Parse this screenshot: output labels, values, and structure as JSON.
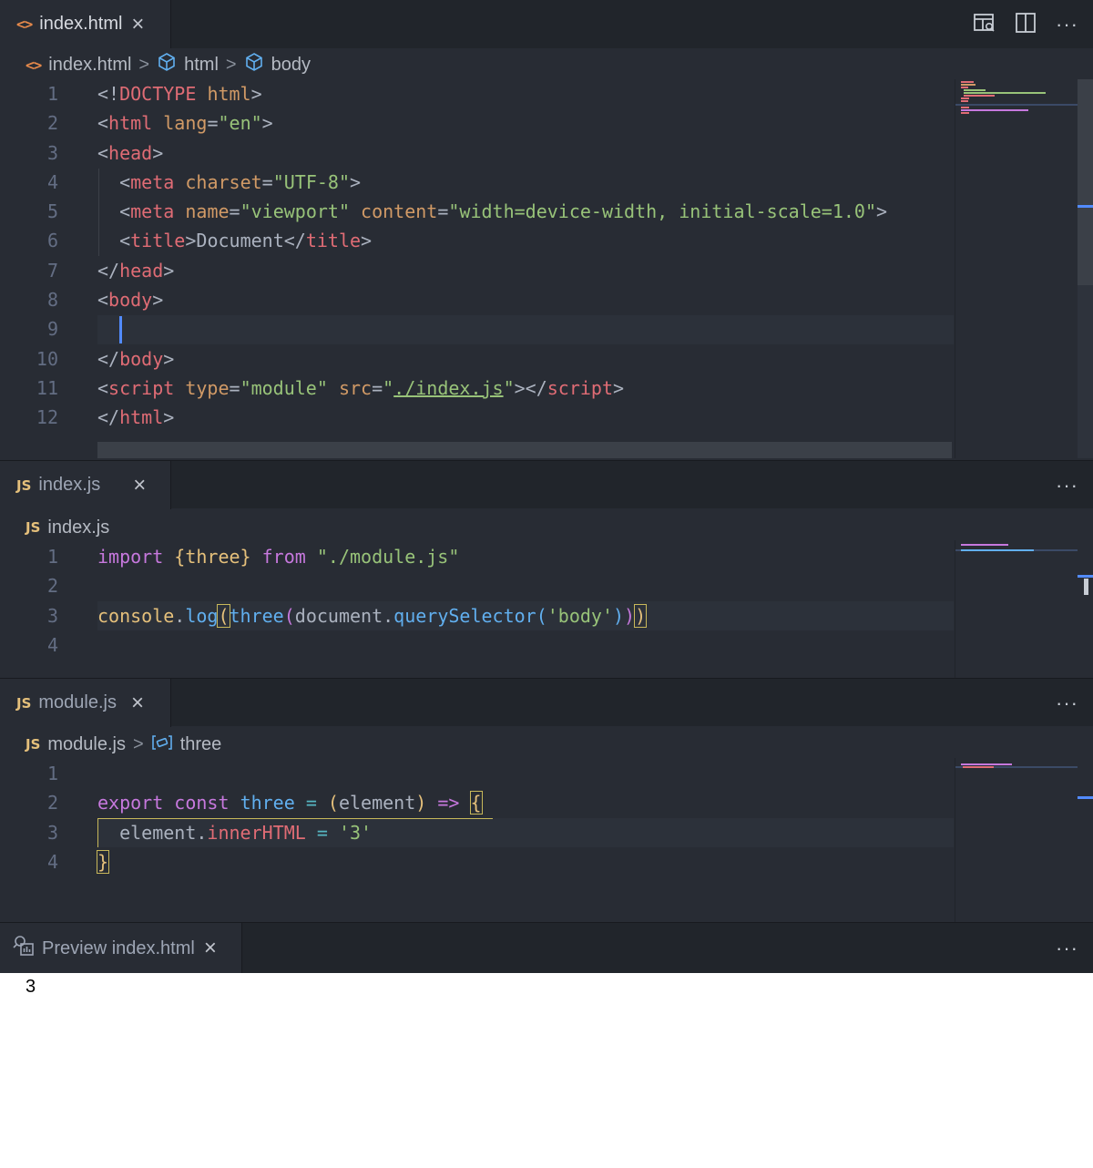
{
  "editor1": {
    "tab_label": "index.html",
    "breadcrumb": [
      "index.html",
      "html",
      "body"
    ],
    "lines": [
      [
        [
          "punc",
          "<!"
        ],
        [
          "tag",
          "DOCTYPE"
        ],
        [
          "plain",
          " "
        ],
        [
          "attr",
          "html"
        ],
        [
          "punc",
          ">"
        ]
      ],
      [
        [
          "punc",
          "<"
        ],
        [
          "tag",
          "html"
        ],
        [
          "plain",
          " "
        ],
        [
          "attr",
          "lang"
        ],
        [
          "punc",
          "="
        ],
        [
          "str",
          "\"en\""
        ],
        [
          "punc",
          ">"
        ]
      ],
      [
        [
          "punc",
          "<"
        ],
        [
          "tag",
          "head"
        ],
        [
          "punc",
          ">"
        ]
      ],
      [
        [
          "plain",
          "  "
        ],
        [
          "punc",
          "<"
        ],
        [
          "tag",
          "meta"
        ],
        [
          "plain",
          " "
        ],
        [
          "attr",
          "charset"
        ],
        [
          "punc",
          "="
        ],
        [
          "str",
          "\"UTF-8\""
        ],
        [
          "punc",
          ">"
        ]
      ],
      [
        [
          "plain",
          "  "
        ],
        [
          "punc",
          "<"
        ],
        [
          "tag",
          "meta"
        ],
        [
          "plain",
          " "
        ],
        [
          "attr",
          "name"
        ],
        [
          "punc",
          "="
        ],
        [
          "str",
          "\"viewport\""
        ],
        [
          "plain",
          " "
        ],
        [
          "attr",
          "content"
        ],
        [
          "punc",
          "="
        ],
        [
          "str",
          "\"width=device-width, initial-scale=1.0\""
        ],
        [
          "punc",
          ">"
        ]
      ],
      [
        [
          "plain",
          "  "
        ],
        [
          "punc",
          "<"
        ],
        [
          "tag",
          "title"
        ],
        [
          "punc",
          ">"
        ],
        [
          "plain",
          "Document"
        ],
        [
          "punc",
          "</"
        ],
        [
          "tag",
          "title"
        ],
        [
          "punc",
          ">"
        ]
      ],
      [
        [
          "punc",
          "</"
        ],
        [
          "tag",
          "head"
        ],
        [
          "punc",
          ">"
        ]
      ],
      [
        [
          "punc",
          "<"
        ],
        [
          "tag",
          "body"
        ],
        [
          "punc",
          ">"
        ]
      ],
      [
        [
          "plain",
          "  "
        ]
      ],
      [
        [
          "punc",
          "</"
        ],
        [
          "tag",
          "body"
        ],
        [
          "punc",
          ">"
        ]
      ],
      [
        [
          "punc",
          "<"
        ],
        [
          "tag",
          "script"
        ],
        [
          "plain",
          " "
        ],
        [
          "attr",
          "type"
        ],
        [
          "punc",
          "="
        ],
        [
          "str",
          "\"module\""
        ],
        [
          "plain",
          " "
        ],
        [
          "attr",
          "src"
        ],
        [
          "punc",
          "="
        ],
        [
          "str",
          "\""
        ],
        [
          "strU",
          "./index.js"
        ],
        [
          "str",
          "\""
        ],
        [
          "punc",
          "></"
        ],
        [
          "tag",
          "script"
        ],
        [
          "punc",
          ">"
        ]
      ],
      [
        [
          "punc",
          "</"
        ],
        [
          "tag",
          "html"
        ],
        [
          "punc",
          ">"
        ]
      ]
    ]
  },
  "editor2": {
    "tab_label": "index.js",
    "breadcrumb": [
      "index.js"
    ],
    "lines": [
      [
        [
          "kw",
          "import"
        ],
        [
          "plain",
          " "
        ],
        [
          "var",
          "{three}"
        ],
        [
          "plain",
          " "
        ],
        [
          "kw",
          "from"
        ],
        [
          "plain",
          " "
        ],
        [
          "str",
          "\"./module.js\""
        ]
      ],
      [],
      [
        [
          "var",
          "console"
        ],
        [
          "plain",
          "."
        ],
        [
          "fn",
          "log"
        ],
        [
          "b1",
          "("
        ],
        [
          "fn",
          "three"
        ],
        [
          "b2",
          "("
        ],
        [
          "plain",
          "document."
        ],
        [
          "fn",
          "querySelector"
        ],
        [
          "b3",
          "("
        ],
        [
          "str",
          "'body'"
        ],
        [
          "b3",
          ")"
        ],
        [
          "b2",
          ")"
        ],
        [
          "b1",
          ")"
        ]
      ],
      []
    ]
  },
  "editor3": {
    "tab_label": "module.js",
    "breadcrumb": [
      "module.js",
      "three"
    ],
    "lines": [
      [],
      [
        [
          "kw",
          "export"
        ],
        [
          "plain",
          " "
        ],
        [
          "kw",
          "const"
        ],
        [
          "plain",
          " "
        ],
        [
          "fn",
          "three"
        ],
        [
          "plain",
          " "
        ],
        [
          "op",
          "="
        ],
        [
          "plain",
          " "
        ],
        [
          "b1",
          "("
        ],
        [
          "plain",
          "element"
        ],
        [
          "b1",
          ")"
        ],
        [
          "plain",
          " "
        ],
        [
          "kw",
          "=>"
        ],
        [
          "plain",
          " "
        ],
        [
          "b1",
          "{"
        ]
      ],
      [
        [
          "plain",
          "  element."
        ],
        [
          "prop",
          "innerHTML"
        ],
        [
          "plain",
          " "
        ],
        [
          "op",
          "="
        ],
        [
          "plain",
          " "
        ],
        [
          "str",
          "'3'"
        ]
      ],
      [
        [
          "b1",
          "}"
        ]
      ]
    ]
  },
  "preview": {
    "tab_label": "Preview index.html",
    "content": "3"
  },
  "icons": {
    "close": "×",
    "more": "···",
    "breadcrumb_sep": ">",
    "html_file": "<>",
    "js_file": "JS"
  }
}
